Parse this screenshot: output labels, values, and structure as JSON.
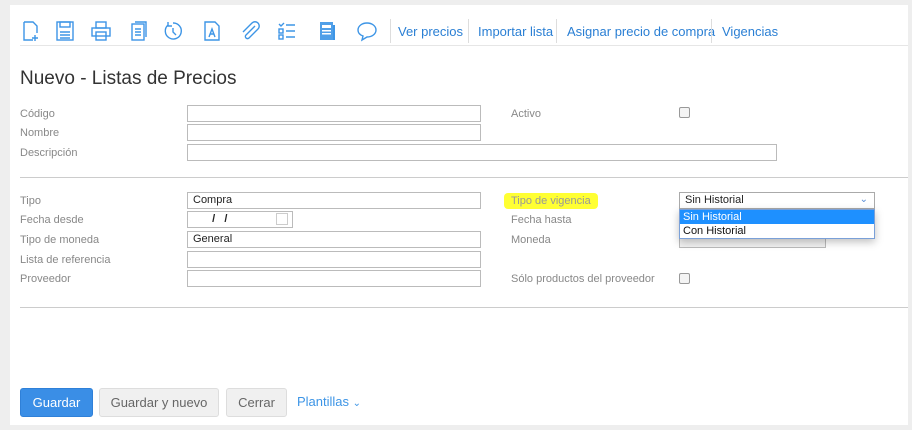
{
  "toolbar": {
    "icons": [
      "new-document-icon",
      "save-icon",
      "print-icon",
      "copy-icon",
      "history-icon",
      "text-document-icon",
      "attachment-icon",
      "checklist-icon",
      "report-icon",
      "comment-icon"
    ],
    "links": [
      "Ver precios",
      "Importar lista",
      "Asignar precio de compra",
      "Vigencias"
    ]
  },
  "title": "Nuevo - Listas de Precios",
  "fields": {
    "codigo": {
      "label": "Código",
      "value": ""
    },
    "nombre": {
      "label": "Nombre",
      "value": ""
    },
    "descripcion": {
      "label": "Descripción",
      "value": ""
    },
    "activo": {
      "label": "Activo",
      "checked": false
    },
    "tipo": {
      "label": "Tipo",
      "value": "Compra"
    },
    "fecha_desde": {
      "label": "Fecha desde",
      "value": "  /   /"
    },
    "tipo_moneda": {
      "label": "Tipo de moneda",
      "value": "General"
    },
    "lista_referencia": {
      "label": "Lista de referencia",
      "value": ""
    },
    "proveedor": {
      "label": "Proveedor",
      "value": ""
    },
    "tipo_vigencia": {
      "label": "Tipo de vigencia",
      "value": "Sin Historial",
      "options": [
        "Sin Historial",
        "Con Historial"
      ]
    },
    "fecha_hasta": {
      "label": "Fecha hasta"
    },
    "moneda": {
      "label": "Moneda",
      "value": ""
    },
    "solo_productos": {
      "label": "Sólo productos del proveedor",
      "checked": false
    }
  },
  "buttons": {
    "guardar": "Guardar",
    "guardar_nuevo": "Guardar y nuevo",
    "cerrar": "Cerrar",
    "plantillas": "Plantillas"
  },
  "colors": {
    "accent": "#3d95e6",
    "highlight": "#ffff33",
    "selected": "#1e90ff"
  }
}
